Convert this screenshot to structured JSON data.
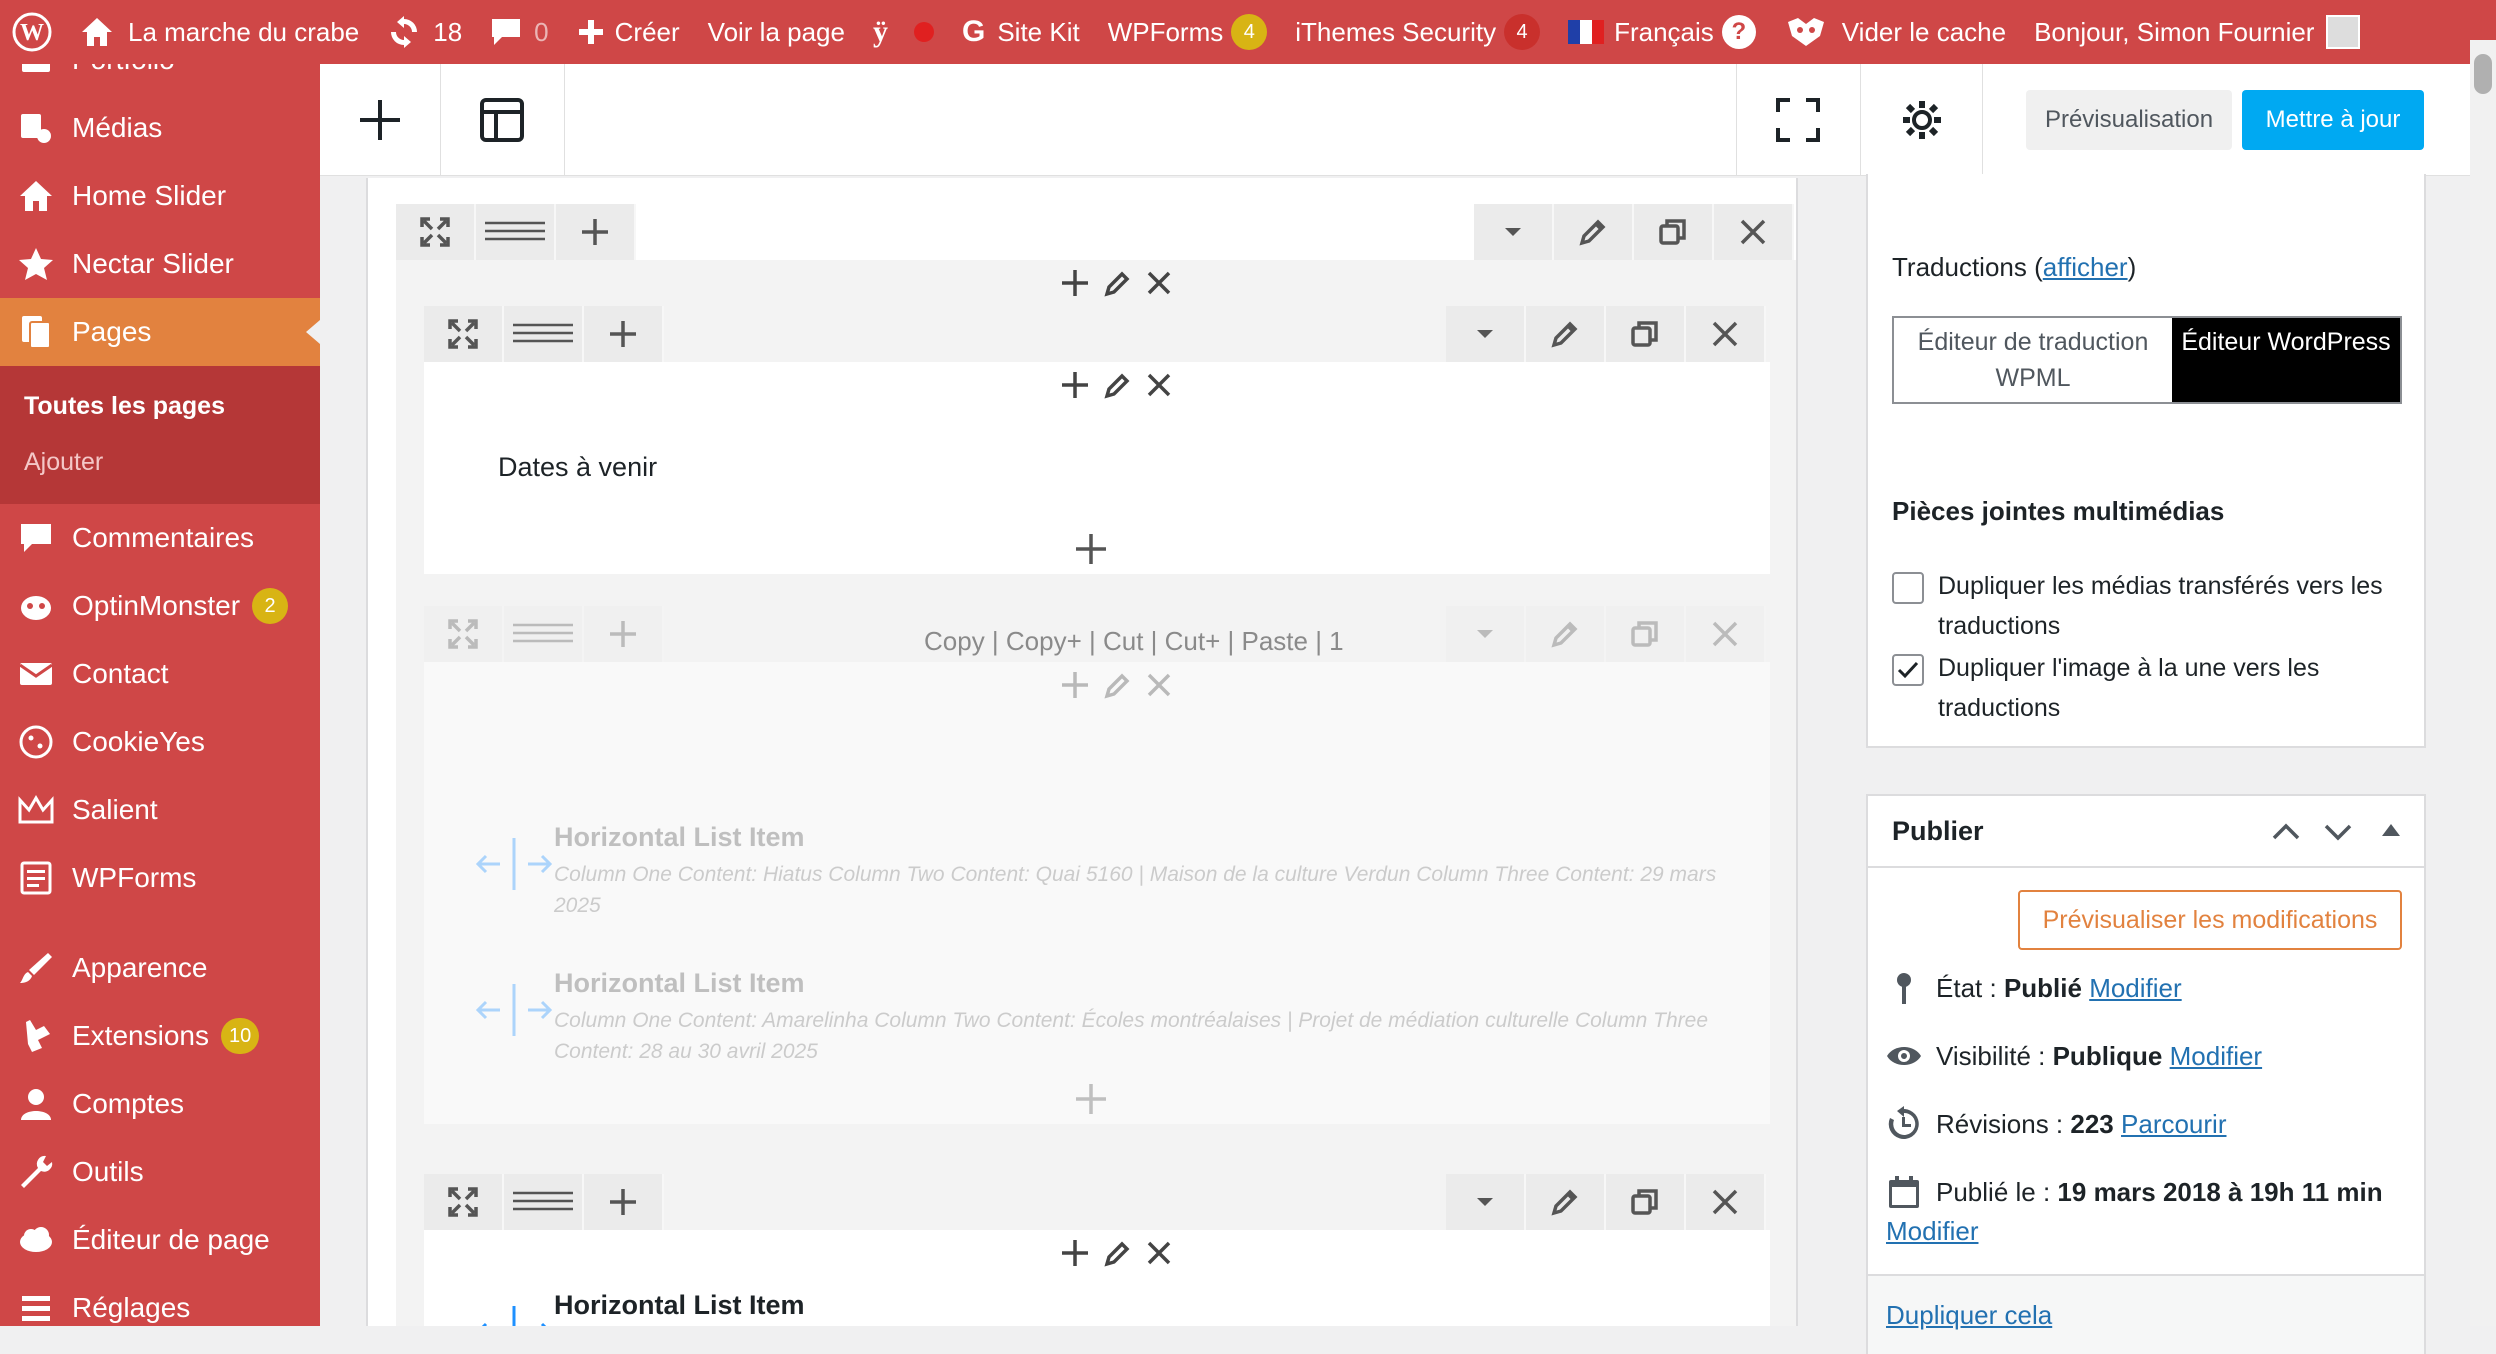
{
  "adminbar": {
    "site": "La marche du crabe",
    "updates": "18",
    "comments": "0",
    "new": "Créer",
    "view": "Voir la page",
    "sitekit": "Site Kit",
    "wpforms": "WPForms",
    "wpforms_count": "4",
    "ithemes": "iThemes Security",
    "ithemes_count": "4",
    "language": "Français",
    "cache": "Vider le cache",
    "greeting": "Bonjour, Simon Fournier"
  },
  "sidebar": {
    "items": [
      {
        "label": "Portfolio",
        "icon": "portfolio-icon"
      },
      {
        "label": "Médias",
        "icon": "media-icon"
      },
      {
        "label": "Home Slider",
        "icon": "home-icon"
      },
      {
        "label": "Nectar Slider",
        "icon": "star-icon"
      },
      {
        "label": "Pages",
        "icon": "pages-icon"
      },
      {
        "label": "Commentaires",
        "icon": "comment-icon"
      },
      {
        "label": "OptinMonster",
        "icon": "optinmonster-icon",
        "badge": "2"
      },
      {
        "label": "Contact",
        "icon": "mail-icon"
      },
      {
        "label": "CookieYes",
        "icon": "cookie-icon"
      },
      {
        "label": "Salient",
        "icon": "crown-icon"
      },
      {
        "label": "WPForms",
        "icon": "wpforms-icon"
      },
      {
        "label": "Apparence",
        "icon": "brush-icon"
      },
      {
        "label": "Extensions",
        "icon": "plugin-icon",
        "badge": "10"
      },
      {
        "label": "Comptes",
        "icon": "user-icon"
      },
      {
        "label": "Outils",
        "icon": "wrench-icon"
      },
      {
        "label": "Éditeur de page",
        "icon": "cloud-icon"
      },
      {
        "label": "Réglages",
        "icon": "settings-icon"
      }
    ],
    "submenu": {
      "all": "Toutes les pages",
      "add": "Ajouter"
    }
  },
  "toolbar": {
    "preview": "Prévisualisation",
    "update": "Mettre à jour"
  },
  "editor": {
    "text1": "Dates à venir",
    "clipboard": "Copy | Copy+ | Cut | Cut+ | Paste | 1",
    "items": [
      {
        "title": "Horizontal List Item",
        "desc": "Column One Content: Hiatus  Column Two Content: Quai 5160 | Maison de la culture Verdun  Column Three Content: 29 mars 2025"
      },
      {
        "title": "Horizontal List Item",
        "desc": "Column One Content: Amarelinha  Column Two Content: Écoles montréalaises | Projet de médiation culturelle  Column Three Content: 28 au 30 avril 2025"
      },
      {
        "title": "Horizontal List Item"
      }
    ]
  },
  "translations": {
    "label": "Traductions",
    "link": "afficher",
    "wpml": "Éditeur de traduction WPML",
    "wp": "Éditeur WordPress"
  },
  "media": {
    "title": "Pièces jointes multimédias",
    "opt1": "Dupliquer les médias transférés vers les traductions",
    "opt1_checked": false,
    "opt2": "Dupliquer l'image à la une vers les traductions",
    "opt2_checked": true
  },
  "publish": {
    "title": "Publier",
    "preview_changes": "Prévisualiser les modifications",
    "status_label": "État :",
    "status": "Publié",
    "visibility_label": "Visibilité :",
    "visibility": "Publique",
    "revisions_label": "Révisions :",
    "revisions": "223",
    "browse": "Parcourir",
    "published_label": "Publié le :",
    "published": "19 mars 2018 à 19h 11 min",
    "modify": "Modifier",
    "duplicate": "Dupliquer cela"
  }
}
